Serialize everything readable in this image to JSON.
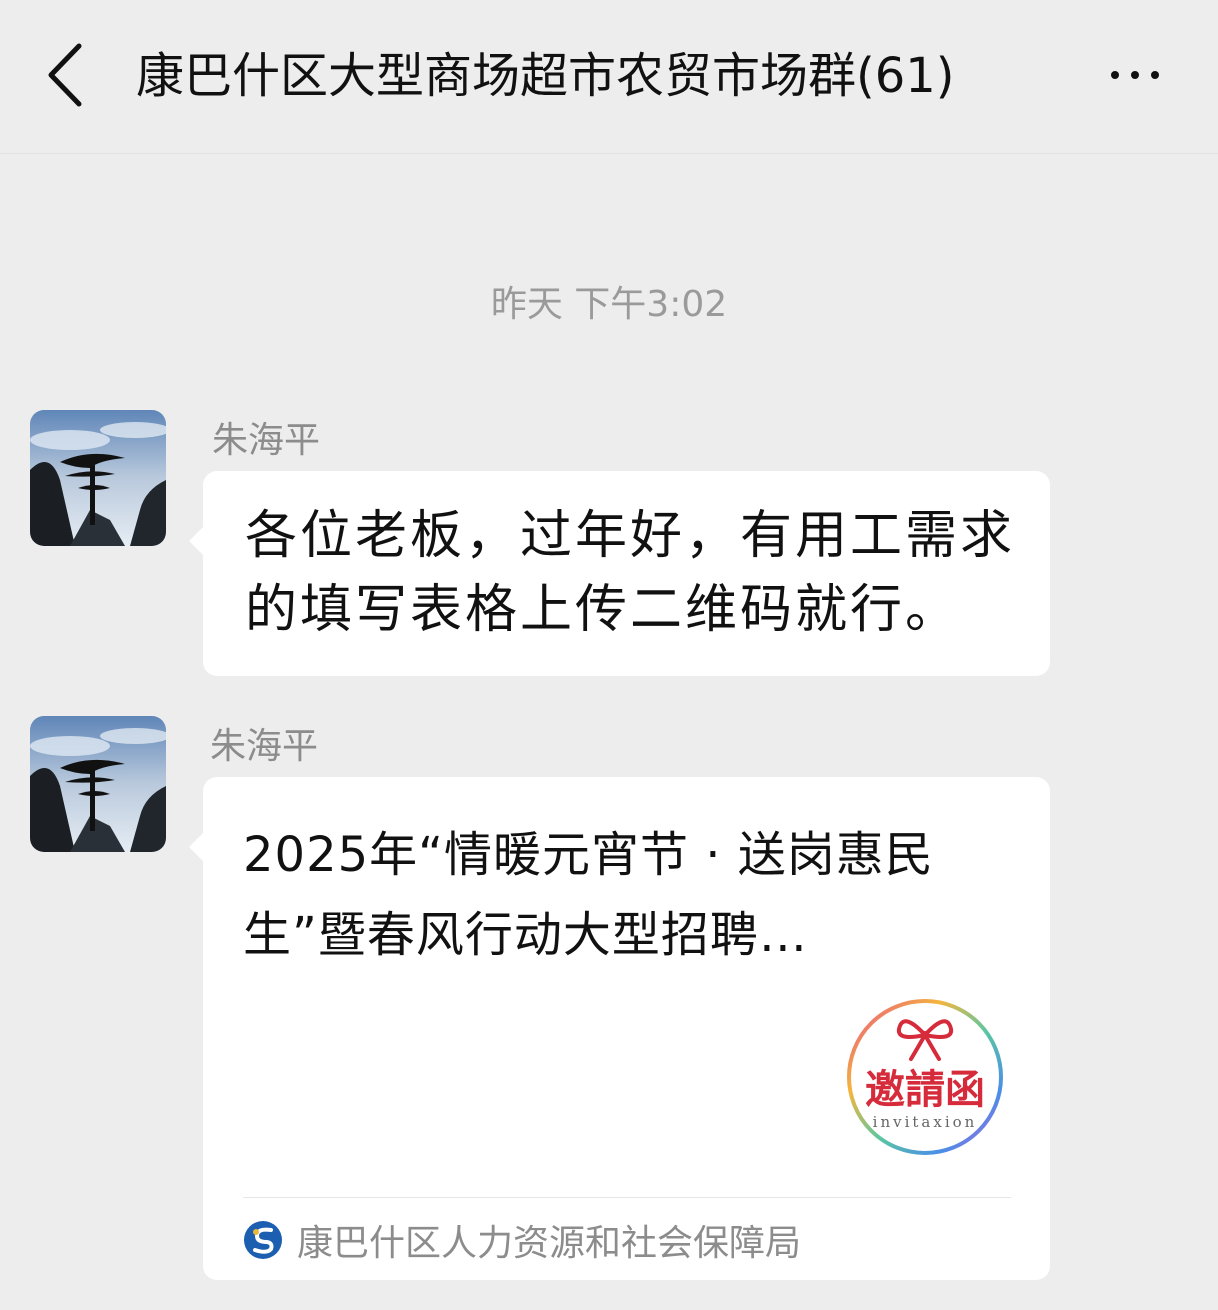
{
  "header": {
    "back_icon": "chevron-left-icon",
    "title": "康巴什区大型商场超市农贸市场群(61)",
    "more_icon": "more-dots-icon"
  },
  "chat": {
    "timestamp": "昨天 下午3:02",
    "messages": [
      {
        "sender": "朱海平",
        "text": "各位老板，过年好，有用工需求的填写表格上传二维码就行。"
      },
      {
        "sender": "朱海平",
        "card": {
          "title": "2025年“情暖元宵节 · 送岗惠民生”暨春风行动大型招聘…",
          "thumb_main_text": "邀請函",
          "thumb_sub_text": "invitaxion",
          "source": "康巴什区人力资源和社会保障局"
        }
      }
    ]
  },
  "colors": {
    "background": "#ededed",
    "bubble": "#ffffff",
    "muted_text": "#8c8c8c",
    "stamp_red": "#d62b3a"
  }
}
